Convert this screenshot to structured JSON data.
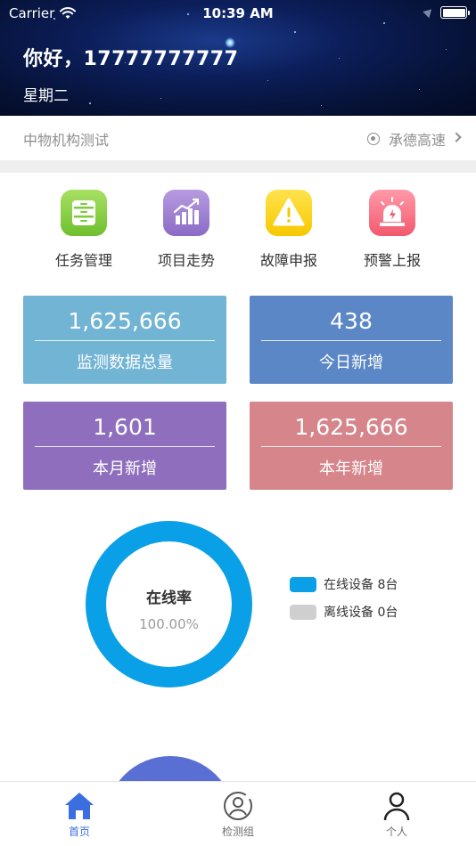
{
  "status_bar": {
    "carrier": "Carrier",
    "time": "10:39 AM"
  },
  "header": {
    "greeting": "你好，17777777777",
    "weekday": "星期二"
  },
  "org": {
    "name": "中物机构测试",
    "road": "承德高速"
  },
  "actions": [
    {
      "label": "任务管理",
      "icon": "cabinet-icon",
      "color": "#7ccb3c"
    },
    {
      "label": "项目走势",
      "icon": "trend-chart-icon",
      "color": "#9a7bd1"
    },
    {
      "label": "故障申报",
      "icon": "warning-icon",
      "color": "#fbd618"
    },
    {
      "label": "预警上报",
      "icon": "alarm-light-icon",
      "color": "#f56c7e"
    }
  ],
  "stats": [
    {
      "value": "1,625,666",
      "label": "监测数据总量",
      "color": "#72b4d4"
    },
    {
      "value": "438",
      "label": "今日新增",
      "color": "#5b87c6"
    },
    {
      "value": "1,601",
      "label": "本月新增",
      "color": "#8f6fbd"
    },
    {
      "value": "1,625,666",
      "label": "本年新增",
      "color": "#d6858b"
    }
  ],
  "online": {
    "title": "在线率",
    "value": "100.00%",
    "online_fraction": 1.0,
    "legend": [
      {
        "label": "在线设备 8台",
        "color": "#0aa0e8"
      },
      {
        "label": "离线设备 0台",
        "color": "#cfcfcf"
      }
    ]
  },
  "tabs": [
    {
      "label": "首页",
      "icon": "home-icon",
      "active": true
    },
    {
      "label": "检测组",
      "icon": "group-icon",
      "active": false
    },
    {
      "label": "个人",
      "icon": "person-icon",
      "active": false
    }
  ],
  "colors": {
    "accent": "#3b6fe0",
    "donut_online": "#0aa0e8"
  }
}
